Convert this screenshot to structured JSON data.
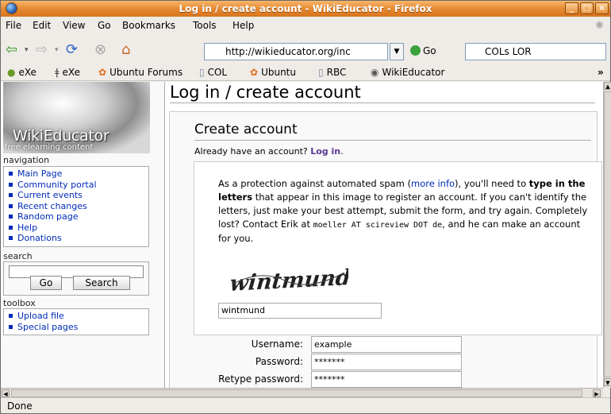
{
  "window": {
    "title": "Log in / create account - WikiEducator - Firefox",
    "controls": [
      "_",
      "□",
      "×"
    ]
  },
  "menubar": [
    "File",
    "Edit",
    "View",
    "Go",
    "Bookmarks",
    "Tools",
    "Help"
  ],
  "navbar": {
    "url": "http://wikieducator.org/inc",
    "go_label": "Go",
    "search_value": "COLs LOR"
  },
  "bookmarks": [
    "eXe",
    "eXe",
    "Ubuntu Forums",
    "COL",
    "Ubuntu",
    "RBC",
    "WikiEducator"
  ],
  "bookmarks_overflow": "»",
  "sidebar": {
    "logo_title": "WikiEducator",
    "logo_subtitle": "free elearning content",
    "navigation_heading": "navigation",
    "navigation_items": [
      "Main Page",
      "Community portal",
      "Current events",
      "Recent changes",
      "Random page",
      "Help",
      "Donations"
    ],
    "search_heading": "search",
    "go_button": "Go",
    "search_button": "Search",
    "toolbox_heading": "toolbox",
    "toolbox_items": [
      "Upload file",
      "Special pages"
    ]
  },
  "main": {
    "page_title": "Log in / create account",
    "create_account_title": "Create account",
    "already_text": "Already have an account?",
    "login_link": "Log in",
    "period": ".",
    "captcha": {
      "t1": "As a protection against automated spam (",
      "link": "more info",
      "t2": "), you'll need to ",
      "bold": "type in the letters",
      "t3": " that appear in this image to register an account. If you can't identify the letters, just make your best attempt, submit the form, and try again. Completely lost? Contact Erik at ",
      "email": "moeller AT scireview DOT de",
      "t4": ", and he can make an account for you.",
      "image_word": "wintmund",
      "input_value": "wintmund"
    },
    "form": {
      "username_label": "Username:",
      "username_value": "example",
      "password_label": "Password:",
      "password_value": "*******",
      "retype_label": "Retype password:",
      "retype_value": "*******"
    }
  },
  "status": "Done"
}
